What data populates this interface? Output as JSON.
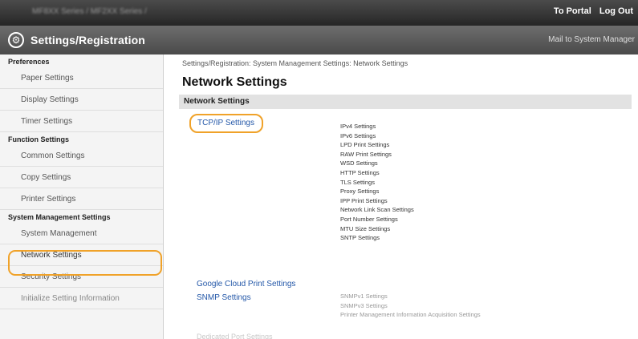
{
  "topbar": {
    "model_text": "MF8XX Series / MF2XX Series /",
    "portal_link": "To Portal",
    "logout_link": "Log Out"
  },
  "titlebar": {
    "title": "Settings/Registration",
    "mail_link": "Mail to System Manager"
  },
  "sidebar": {
    "groups": [
      {
        "heading": "Preferences",
        "items": [
          "Paper Settings",
          "Display Settings",
          "Timer Settings"
        ]
      },
      {
        "heading": "Function Settings",
        "items": [
          "Common Settings",
          "Copy Settings",
          "Printer Settings"
        ]
      },
      {
        "heading": "System Management Settings",
        "items": [
          "System Management",
          "Network Settings",
          "Security Settings",
          "Initialize Setting Information"
        ]
      }
    ],
    "selected": "Network Settings"
  },
  "main": {
    "breadcrumb": "Settings/Registration: System Management Settings: Network Settings",
    "page_title": "Network Settings",
    "section_title": "Network Settings",
    "links": {
      "tcpip": "TCP/IP Settings",
      "google_cloud": "Google Cloud Print Settings",
      "snmp": "SNMP Settings",
      "dedicated_port": "Dedicated Port Settings"
    },
    "tcpip_items": [
      "IPv4 Settings",
      "IPv6 Settings",
      "LPD Print Settings",
      "RAW Print Settings",
      "WSD Settings",
      "HTTP Settings",
      "TLS Settings",
      "Proxy Settings",
      "IPP Print Settings",
      "Network Link Scan Settings",
      "Port Number Settings",
      "MTU Size Settings",
      "SNTP Settings"
    ],
    "snmp_items": [
      "SNMPv1 Settings",
      "SNMPv3 Settings",
      "Printer Management Information Acquisition Settings"
    ]
  },
  "colors": {
    "highlight": "#f0a229",
    "link": "#2357a8"
  }
}
